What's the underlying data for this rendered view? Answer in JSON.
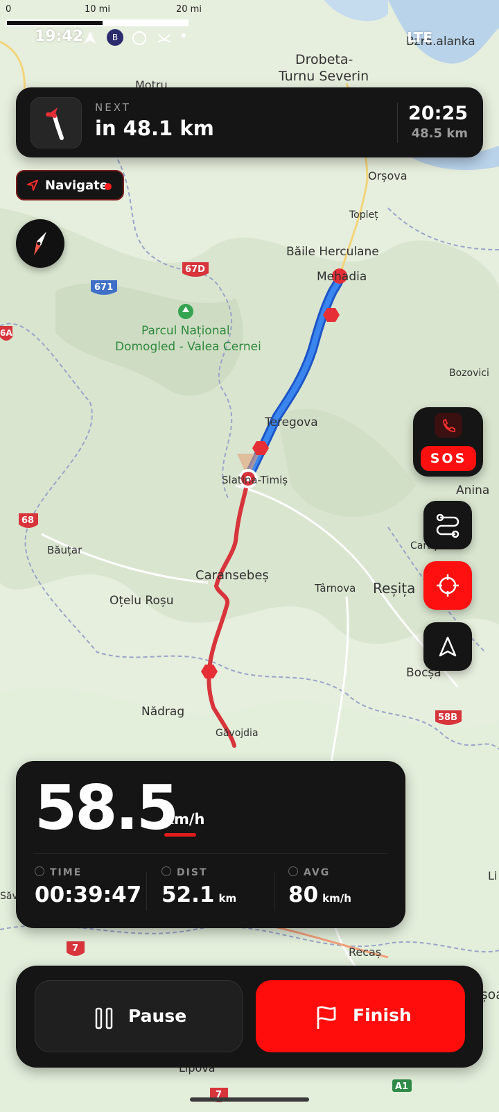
{
  "scale_bar": {
    "labels": [
      "0",
      "10 mi",
      "20 mi"
    ]
  },
  "status_bar": {
    "time": "19:42",
    "badge_letter": "B",
    "network": "LTE"
  },
  "map": {
    "labels": {
      "top_right_town": "Bzra.alanka",
      "drobeta_1": "Drobeta-",
      "drobeta_2": "Turnu Severin",
      "motru": "Motru",
      "orsova": "Orșova",
      "toplet": "Topleț",
      "baile": "Băile Herculane",
      "mehadia": "Mehadia",
      "park_1": "Parcul Național",
      "park_2": "Domogled - Valea Cernei",
      "bozovici": "Bozovici",
      "teregova": "Teregova",
      "slatina": "Slatina-Timiș",
      "anina": "Anina",
      "bautar": "Băuțar",
      "caras": "Caraș",
      "caransebes": "Caransebeș",
      "otelu": "Oțelu Roșu",
      "tarnova": "Târnova",
      "resita": "Reșița",
      "bocsa": "Bocșa",
      "nadrag": "Nădrag",
      "gavojdia": "Găvojdia",
      "recas": "Recaș",
      "lipova": "Lipova",
      "sav": "Săv",
      "li": "Li",
      "timisoara_cut": "mișoa",
      "shield_671": "671",
      "shield_67d": "67D",
      "shield_68": "68",
      "shield_58b": "58B",
      "shield_7a": "7",
      "shield_7b": "7",
      "shield_6a": "6A",
      "shield_a1": "A1"
    }
  },
  "navigation": {
    "next_label": "NEXT",
    "next_distance": "in 48.1 km",
    "eta_time": "20:25",
    "eta_distance": "48.5 km",
    "navigate_label": "Navigate"
  },
  "sos": {
    "label": "SOS"
  },
  "stats": {
    "speed": "58.5",
    "speed_unit": "km/h",
    "time_label": "TIME",
    "time_value": "00:39:47",
    "dist_label": "DIST",
    "dist_value": "52.1",
    "dist_unit": "km",
    "avg_label": "AVG",
    "avg_value": "80",
    "avg_unit": "km/h"
  },
  "controls": {
    "pause_label": "Pause",
    "finish_label": "Finish"
  },
  "colors": {
    "accent_red": "#ff0c0c",
    "route_done": "#2f6fdf",
    "route_planned": "#d8343c",
    "card": "#151515"
  }
}
